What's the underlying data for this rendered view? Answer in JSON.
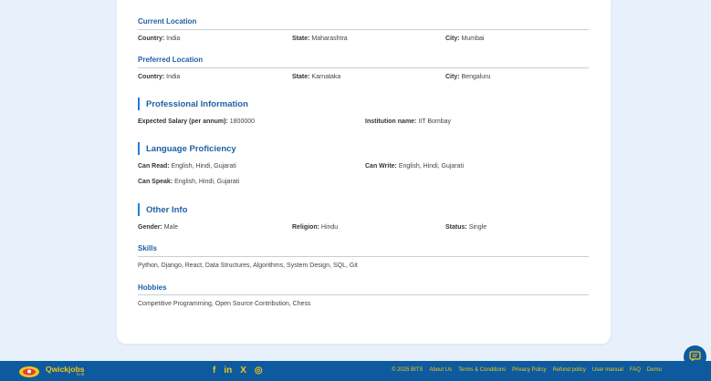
{
  "profile": {
    "current_location": {
      "title": "Current Location",
      "country_label": "Country:",
      "country": "India",
      "state_label": "State:",
      "state": "Maharashtra",
      "city_label": "City:",
      "city": "Mumbai"
    },
    "preferred_location": {
      "title": "Preferred Location",
      "country_label": "Country:",
      "country": "India",
      "state_label": "State:",
      "state": "Karnataka",
      "city_label": "City:",
      "city": "Bengaluru"
    },
    "professional": {
      "title": "Professional Information",
      "salary_label": "Expected Salary (per annum):",
      "salary": "1800000",
      "institution_label": "Institution name:",
      "institution": "IIT Bombay"
    },
    "language": {
      "title": "Language Proficiency",
      "read_label": "Can Read:",
      "read": "English, Hindi, Gujarati",
      "write_label": "Can Write:",
      "write": "English, Hindi, Gujarati",
      "speak_label": "Can Speak:",
      "speak": "English, Hindi, Gujarati"
    },
    "other": {
      "title": "Other Info",
      "gender_label": "Gender:",
      "gender": "Male",
      "religion_label": "Religion:",
      "religion": "Hindu",
      "status_label": "Status:",
      "status": "Single"
    },
    "skills": {
      "title": "Skills",
      "value": "Python, Django, React, Data Structures, Algorithms, System Design, SQL, Git"
    },
    "hobbies": {
      "title": "Hobbies",
      "value": "Competitive Programming, Open Source Contribution, Chess"
    }
  },
  "footer": {
    "brand": "Qwickjobs",
    "tagline": "to it!",
    "social": [
      "f",
      "in",
      "X",
      "◎"
    ],
    "links": [
      "© 2025 BITS",
      "About Us",
      "Terms & Conditions",
      "Privacy Policy",
      "Refund policy",
      "User manual",
      "FAQ",
      "Demo"
    ]
  },
  "colors": {
    "accent": "#1f5fa8",
    "footer_bg": "#0d5a9e",
    "footer_text": "#f5c518",
    "page_bg": "#e8f0fb"
  },
  "icons": {
    "chat": "chat-bubble-icon",
    "logo": "qwickjobs-logo-icon"
  }
}
